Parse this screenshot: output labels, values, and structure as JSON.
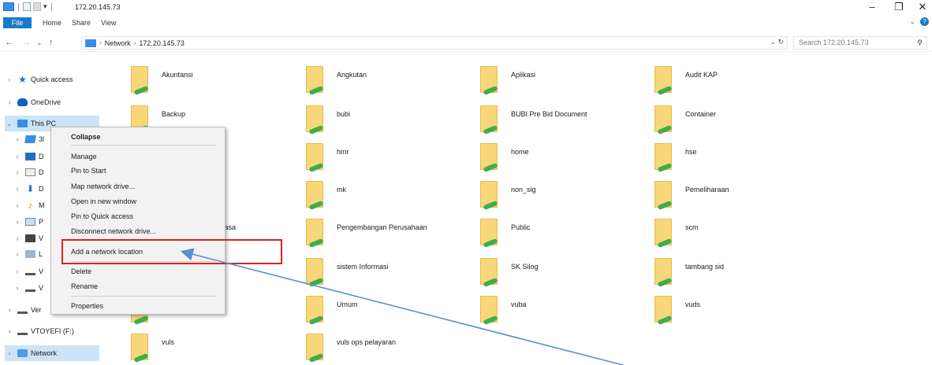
{
  "window": {
    "title": "172.20.145.73",
    "minimize": "–",
    "maximize": "❐",
    "close": "✕"
  },
  "ribbon": {
    "file": "File",
    "tabs": [
      "Home",
      "Share",
      "View"
    ],
    "expand": "⌄",
    "help": "?"
  },
  "address": {
    "back": "←",
    "forward": "→",
    "recent": "⌄",
    "up": "↑",
    "crumbs": [
      "Network",
      "172.20.145.73"
    ],
    "sep": "›",
    "controls": "⌄ ↻",
    "search_placeholder": "Search 172.20.145.73",
    "search_icon": "⚲"
  },
  "sidebar": {
    "items": [
      {
        "label": "Quick access",
        "chev": "›",
        "icon": "star-icon"
      },
      {
        "label": "OneDrive",
        "chev": "›",
        "icon": "cloud-icon"
      },
      {
        "label": "This PC",
        "chev": "⌄",
        "icon": "computer-icon"
      },
      {
        "label": "3l",
        "chev": "›",
        "icon": "3d-objects-icon"
      },
      {
        "label": "D",
        "chev": "›",
        "icon": "desktop-icon"
      },
      {
        "label": "D",
        "chev": "›",
        "icon": "documents-icon"
      },
      {
        "label": "D",
        "chev": "›",
        "icon": "downloads-icon"
      },
      {
        "label": "M",
        "chev": "›",
        "icon": "music-icon"
      },
      {
        "label": "P",
        "chev": "›",
        "icon": "pictures-icon"
      },
      {
        "label": "V",
        "chev": "›",
        "icon": "videos-icon"
      },
      {
        "label": "L",
        "chev": "›",
        "icon": "local-disk-icon"
      },
      {
        "label": "V",
        "chev": "›",
        "icon": "drive-icon"
      },
      {
        "label": "V",
        "chev": "›",
        "icon": "drive-icon"
      },
      {
        "label": "Ver",
        "chev": "›",
        "icon": "drive-icon"
      },
      {
        "label": "VTOYEFI (F:)",
        "chev": "›",
        "icon": "drive-icon"
      },
      {
        "label": "Network",
        "chev": "›",
        "icon": "network-icon"
      }
    ]
  },
  "folders": [
    "Akuntansi",
    "Angkutan",
    "Aplikasi",
    "Audit KAP",
    "Backup",
    "bubi",
    "BUBI Pre Bid Document",
    "Container",
    "hmr",
    "home",
    "hse",
    "mk",
    "non_sig",
    "Pemeliharaan",
    "ng & Jasa",
    "Pengembangan Perusahaan",
    "Public",
    "scm",
    "sistem Informasi",
    "SK Silog",
    "tambang sid",
    "Umum",
    "vuba",
    "vuds",
    "vuls",
    "vuls ops pelayaran"
  ],
  "context_menu": {
    "items": [
      {
        "label": "Collapse",
        "bold": true
      },
      {
        "label": "Manage"
      },
      {
        "label": "Pin to Start"
      },
      {
        "label": "Map network drive..."
      },
      {
        "label": "Open in new window"
      },
      {
        "label": "Pin to Quick access"
      },
      {
        "label": "Disconnect network drive..."
      },
      {
        "label": "Add a network location"
      },
      {
        "label": "Delete"
      },
      {
        "label": "Rename"
      },
      {
        "label": "Properties"
      }
    ]
  },
  "annotation": {
    "highlight_color": "#e0201f",
    "arrow_color": "#5b8fd0"
  }
}
